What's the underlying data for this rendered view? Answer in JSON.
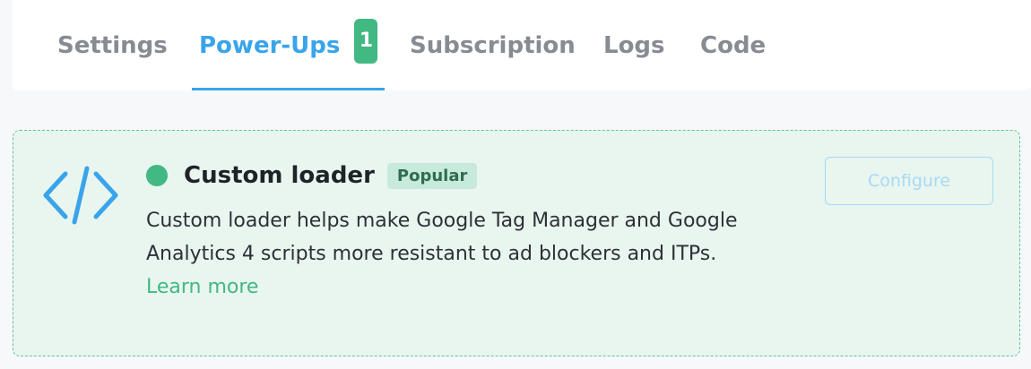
{
  "tabs": [
    {
      "label": "Settings",
      "active": false
    },
    {
      "label": "Power-Ups",
      "active": true,
      "badge": "1"
    },
    {
      "label": "Subscription",
      "active": false
    },
    {
      "label": "Logs",
      "active": false
    },
    {
      "label": "Code",
      "active": false
    }
  ],
  "card": {
    "icon": "code-brackets-icon",
    "status": "active",
    "title": "Custom loader",
    "badge": "Popular",
    "description": "Custom loader helps make Google Tag Manager and Google Analytics 4 scripts more resistant to ad blockers and ITPs.",
    "learn_more": "Learn more",
    "configure_label": "Configure"
  },
  "colors": {
    "accent": "#3aa4ea",
    "success": "#42b883",
    "card_background": "#e8f6ef",
    "tab_inactive": "#878b92"
  }
}
